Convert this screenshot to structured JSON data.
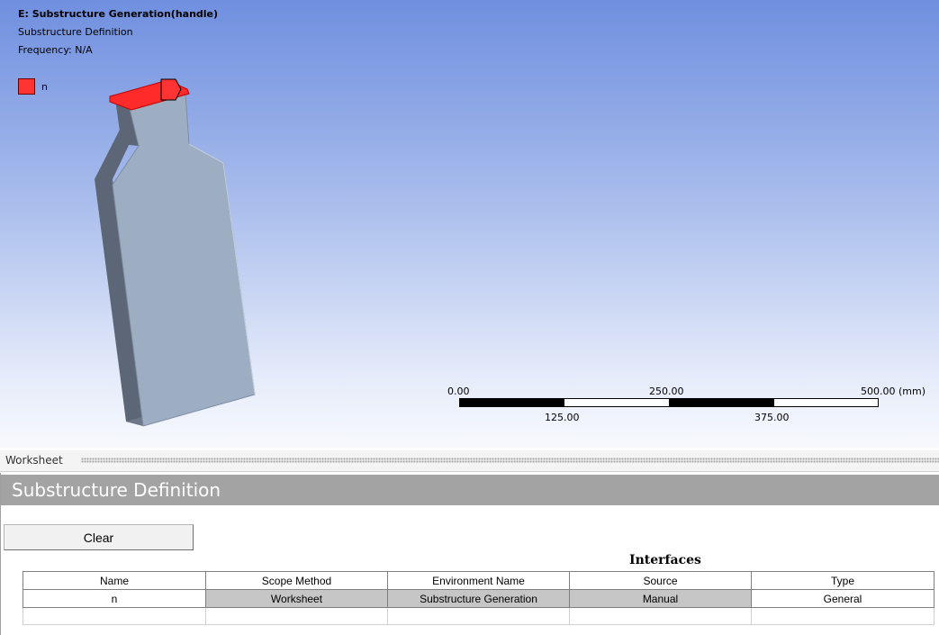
{
  "viewport": {
    "title": "E: Substructure Generation(handle)",
    "subtitle": "Substructure Definition",
    "frequency": "Frequency: N/A",
    "legend": {
      "label": "n",
      "color": "#ff3333"
    }
  },
  "scale": {
    "unit": "(mm)",
    "top_ticks": [
      "0.00",
      "250.00",
      "500.00 (mm)"
    ],
    "bottom_ticks": [
      "125.00",
      "375.00"
    ]
  },
  "worksheet": {
    "tab_label": "Worksheet",
    "section_title": "Substructure Definition",
    "clear_label": "Clear",
    "table_title": "Interfaces",
    "columns": [
      "Name",
      "Scope Method",
      "Environment Name",
      "Source",
      "Type"
    ],
    "rows": [
      {
        "name": "n",
        "scope_method": "Worksheet",
        "environment_name": "Substructure Generation",
        "source": "Manual",
        "type": "General"
      }
    ]
  }
}
